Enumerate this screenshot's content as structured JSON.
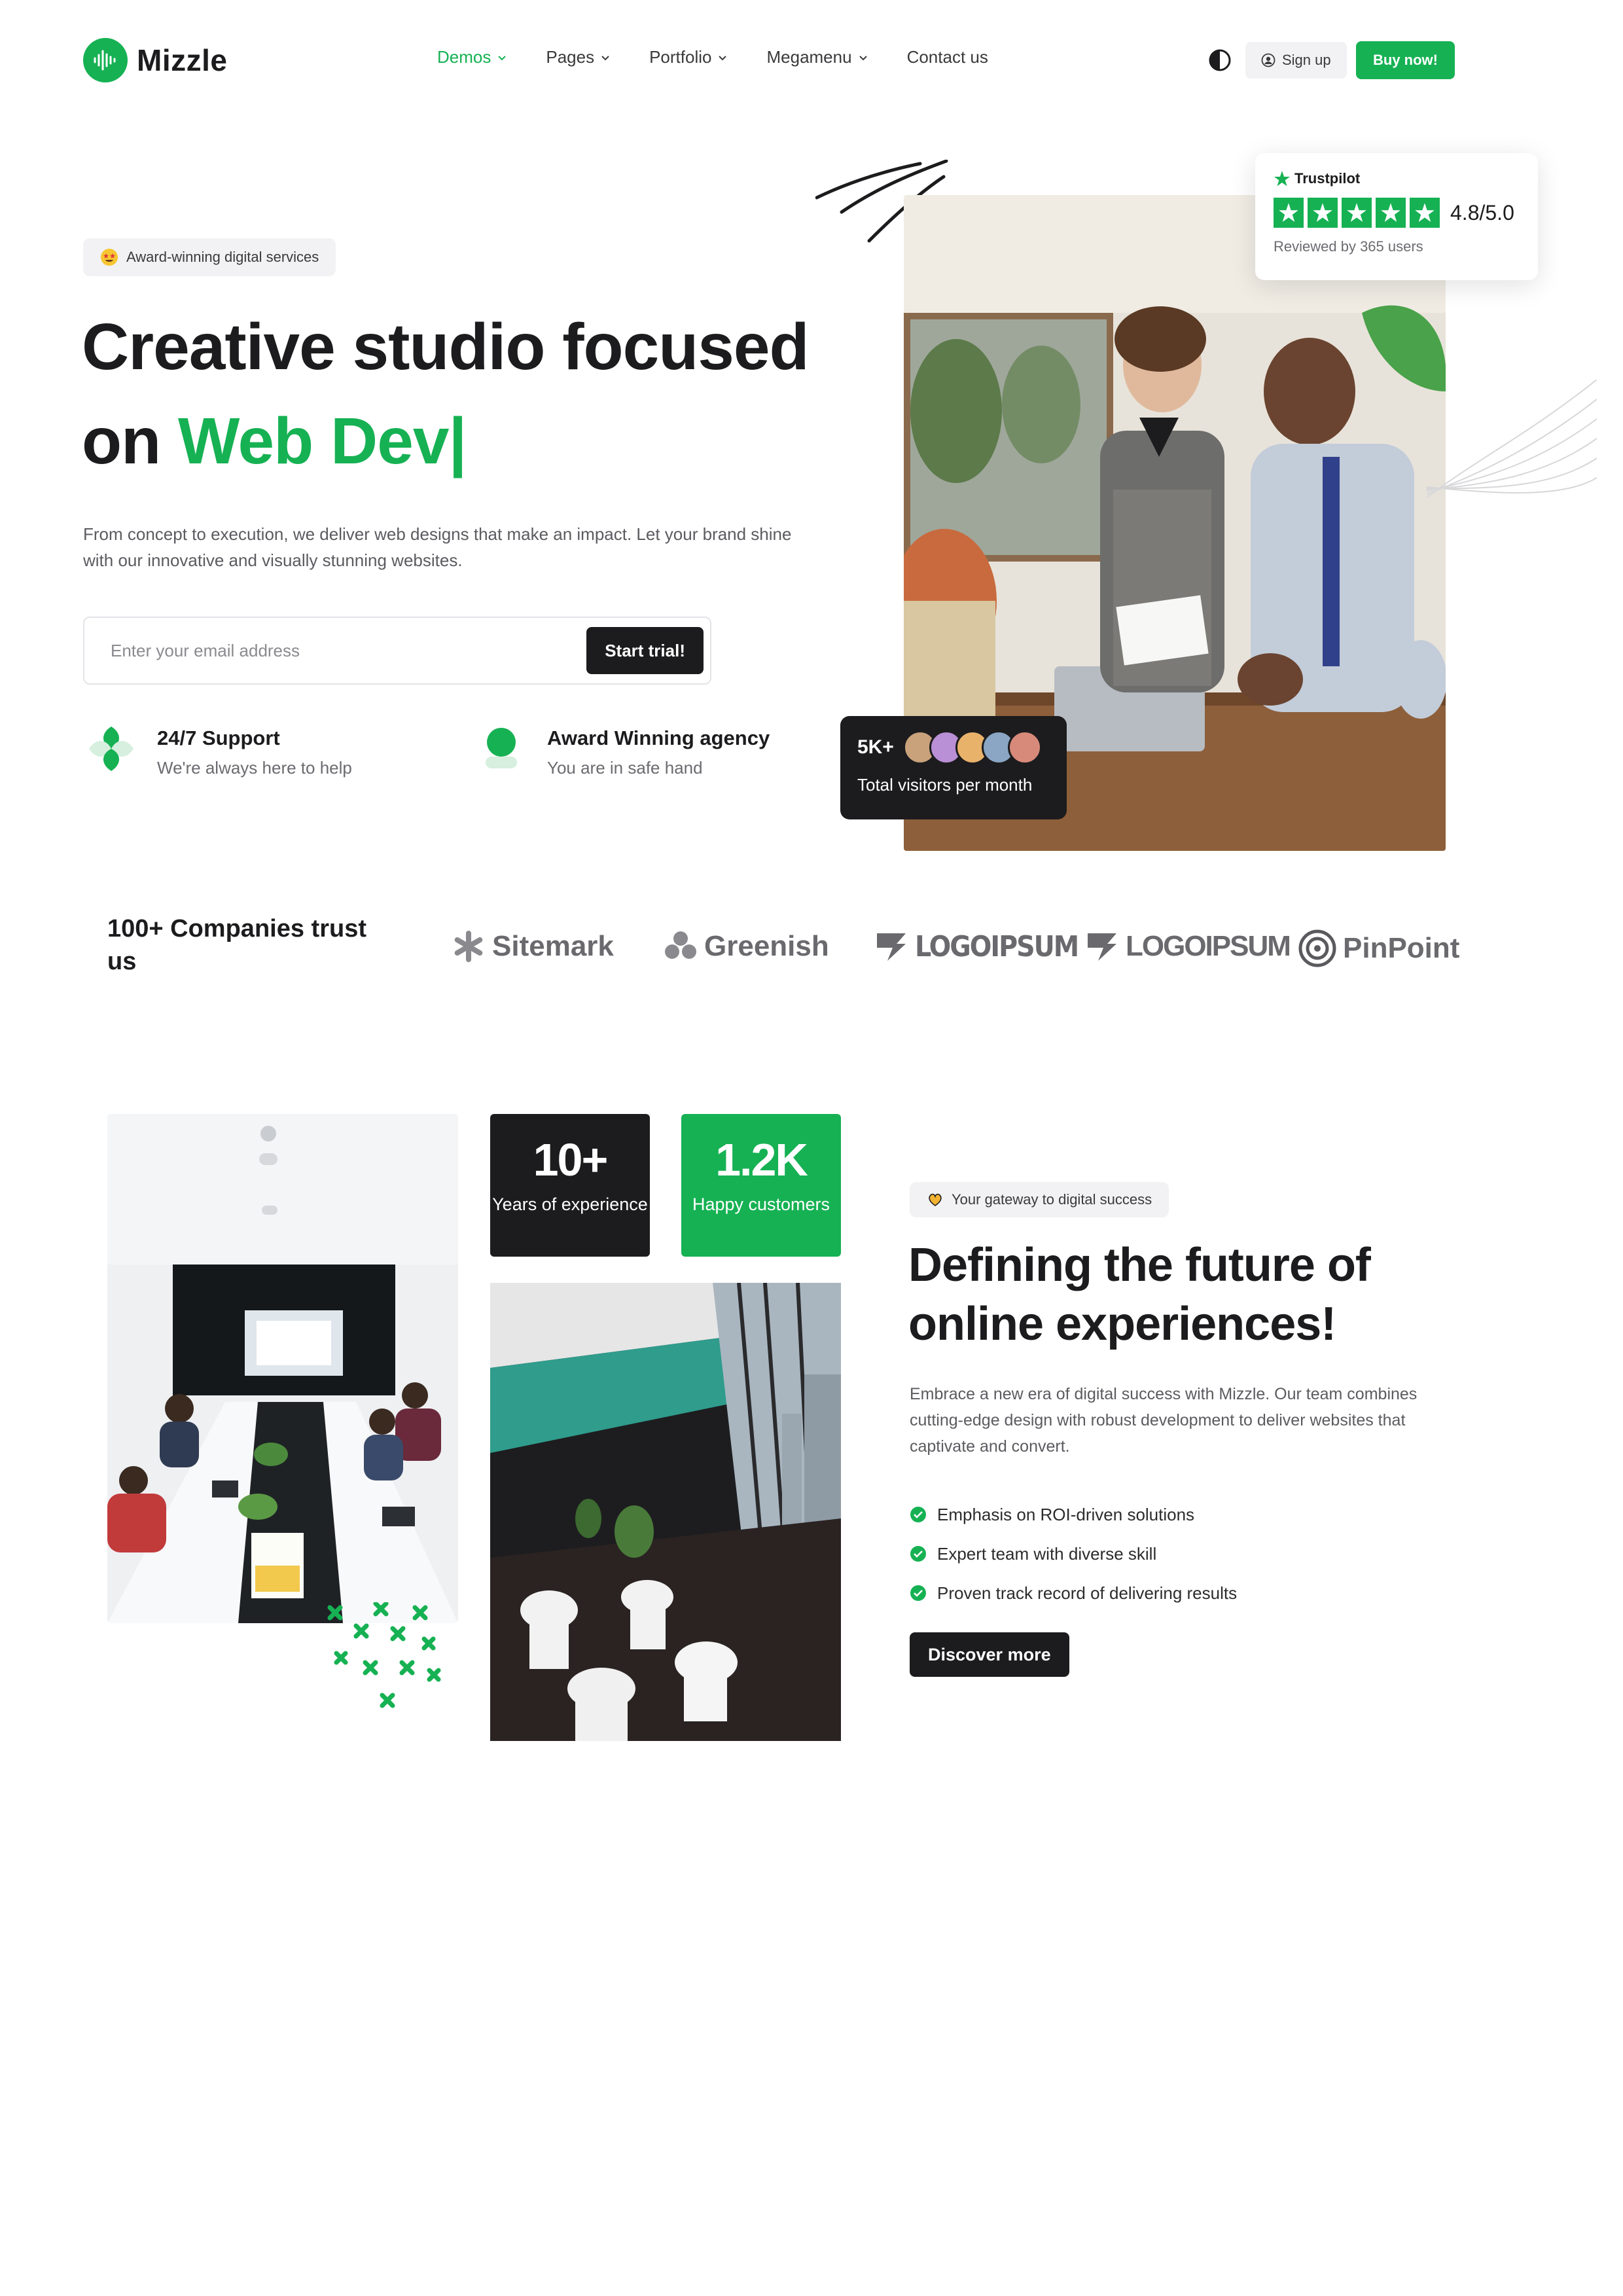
{
  "brand": {
    "name": "Mizzle"
  },
  "nav": {
    "items": [
      {
        "label": "Demos",
        "active": true
      },
      {
        "label": "Pages",
        "active": false
      },
      {
        "label": "Portfolio",
        "active": false
      },
      {
        "label": "Megamenu",
        "active": false
      },
      {
        "label": "Contact us",
        "active": false
      }
    ]
  },
  "header": {
    "signup_label": "Sign up",
    "buynow_label": "Buy now!",
    "theme_icon": "half-circle-icon"
  },
  "hero": {
    "badge": "Award-winning digital services",
    "title_line1": "Creative studio focused",
    "title_prefix": "on ",
    "title_highlight": "Web Dev|",
    "description": "From concept to execution, we deliver web designs that make an impact. Let your brand shine with our innovative and visually stunning websites.",
    "email_placeholder": "Enter your email address",
    "cta_label": "Start trial!",
    "features": [
      {
        "title": "24/7 Support",
        "subtitle": "We're always here to help"
      },
      {
        "title": "Award Winning agency",
        "subtitle": "You are in safe hand"
      }
    ]
  },
  "trustpilot": {
    "brand": "Trustpilot",
    "score": "4.8/5.0",
    "reviewed": "Reviewed by 365 users",
    "stars": 5
  },
  "visitors": {
    "count": "5K+",
    "label": "Total visitors per month"
  },
  "companies": {
    "title": "100+ Companies trust us",
    "logos": [
      "Sitemark",
      "Greenish",
      "LOGOIPSUM",
      "LOGOIPSUM",
      "PinPoint"
    ]
  },
  "stats": [
    {
      "value": "10+",
      "label": "Years of experience"
    },
    {
      "value": "1.2K",
      "label": "Happy customers"
    }
  ],
  "about": {
    "badge": "Your gateway to digital success",
    "title": "Defining the future of online experiences!",
    "description": "Embrace a new era of digital success with Mizzle. Our team combines cutting-edge design with robust development to deliver websites that captivate and convert.",
    "bullets": [
      "Emphasis on ROI-driven solutions",
      "Expert team with diverse skill",
      "Proven track record of delivering results"
    ],
    "cta_label": "Discover more"
  },
  "colors": {
    "accent": "#16b153",
    "dark": "#1c1c1e",
    "muted": "#f2f2f4"
  }
}
